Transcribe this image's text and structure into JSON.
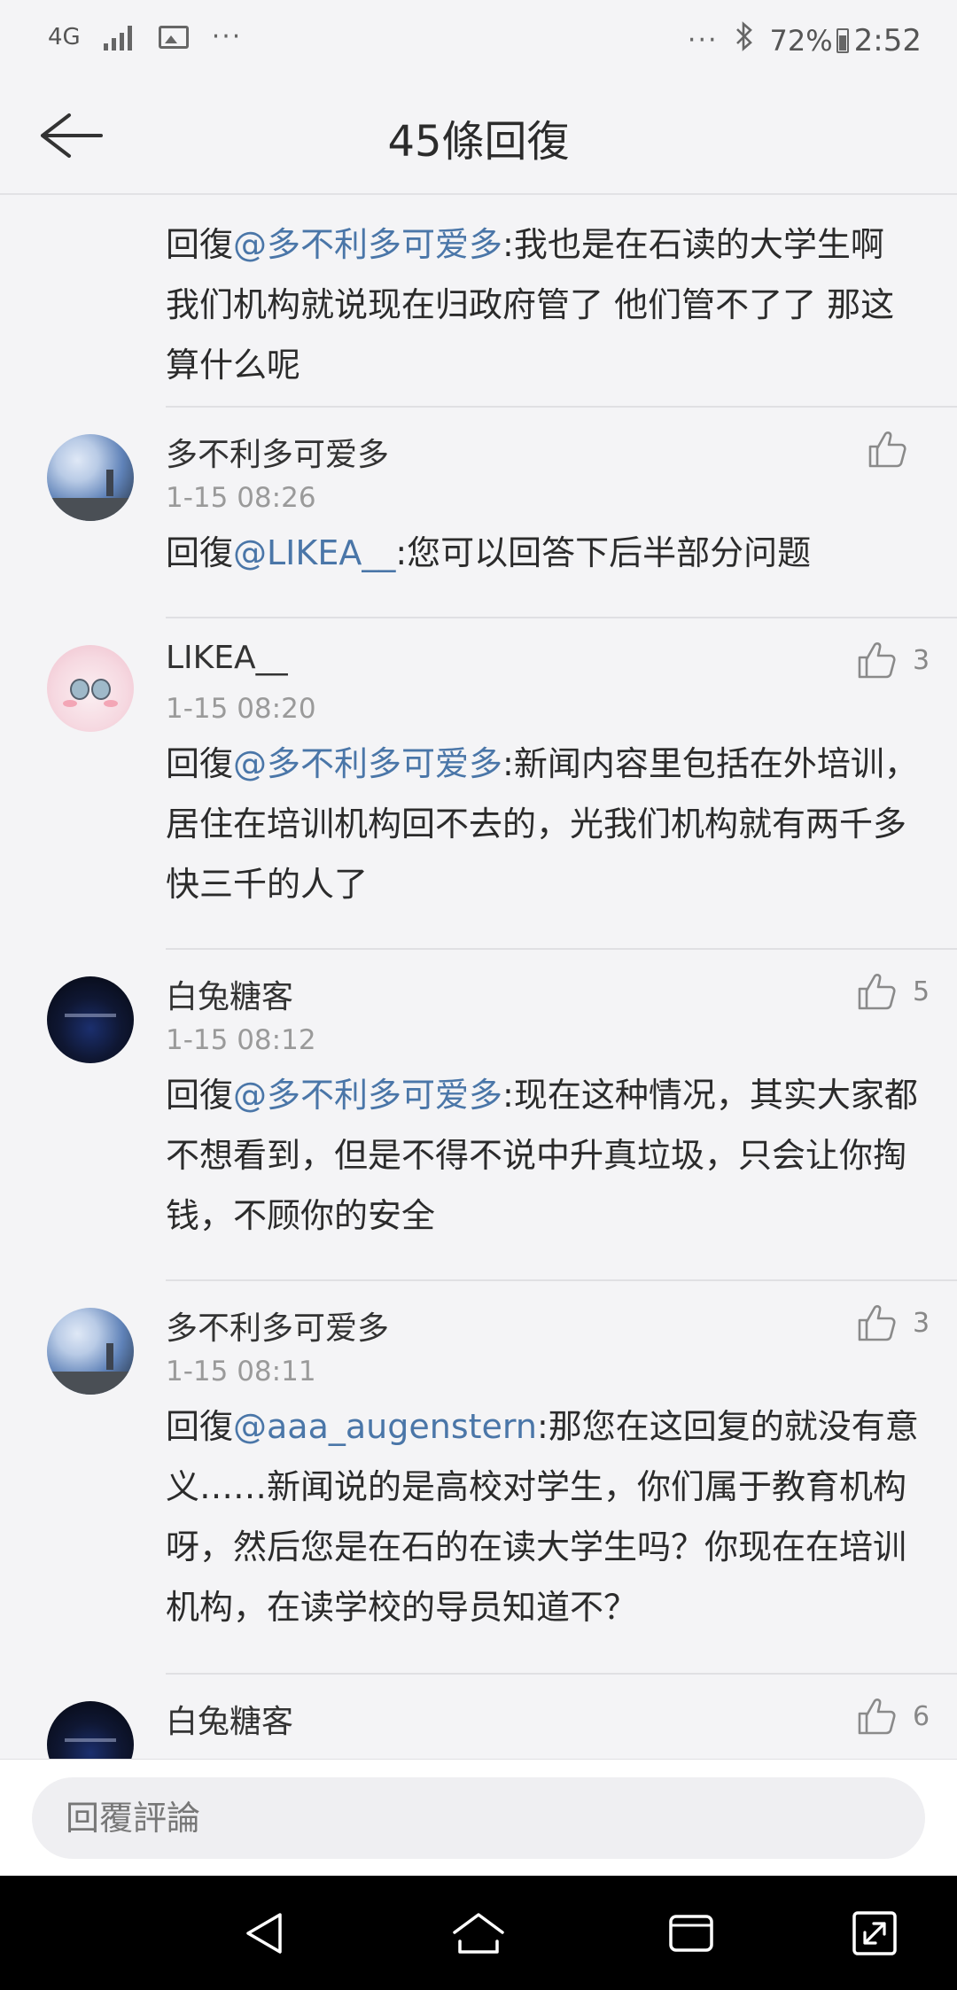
{
  "status_bar": {
    "network": "4G",
    "dots_left": "···",
    "dots_right": "···",
    "battery": "72%",
    "time": "2:52"
  },
  "header": {
    "title": "45條回復"
  },
  "comments": [
    {
      "name": "",
      "time": "",
      "reply_prefix": "回復",
      "mention": "@多不利多可爱多",
      "text": ":我也是在石读的大学生啊 我们机构就说现在归政府管了 他们管不了了 那这算什么呢",
      "likes": ""
    },
    {
      "name": "多不利多可爱多",
      "time": "1-15 08:26",
      "reply_prefix": "回復",
      "mention": "@LIKEA__",
      "text": ":您可以回答下后半部分问题",
      "likes": ""
    },
    {
      "name": "LIKEA__",
      "time": "1-15 08:20",
      "reply_prefix": "回復",
      "mention": "@多不利多可爱多",
      "text": ":新闻内容里包括在外培训，居住在培训机构回不去的，光我们机构就有两千多快三千的人了",
      "likes": "3"
    },
    {
      "name": "白兔糖客",
      "time": "1-15 08:12",
      "reply_prefix": "回復",
      "mention": "@多不利多可爱多",
      "text": ":现在这种情况，其实大家都不想看到，但是不得不说中升真垃圾，只会让你掏钱，不顾你的安全",
      "likes": "5"
    },
    {
      "name": "多不利多可爱多",
      "time": "1-15 08:11",
      "reply_prefix": "回復",
      "mention": "@aaa_augenstern",
      "text": ":那您在这回复的就没有意义……新闻说的是高校对学生，你们属于教育机构呀，然后您是在石的在读大学生吗？你现在在培训机构，在读学校的导员知道不？",
      "likes": "3"
    },
    {
      "name": "白兔糖客",
      "time": "",
      "reply_prefix": "",
      "mention": "",
      "text": "",
      "likes": "6"
    }
  ],
  "reply_bar": {
    "placeholder": "回覆評論"
  },
  "icons": {
    "back": "arrow-left-icon",
    "like": "thumbs-up-icon",
    "nav_back": "triangle-back-icon",
    "nav_home": "home-icon",
    "nav_recents": "recents-icon",
    "nav_expand": "expand-icon"
  },
  "colors": {
    "mention": "#4a76a8",
    "background": "#f4f4f6",
    "nav_bar": "#000000"
  }
}
